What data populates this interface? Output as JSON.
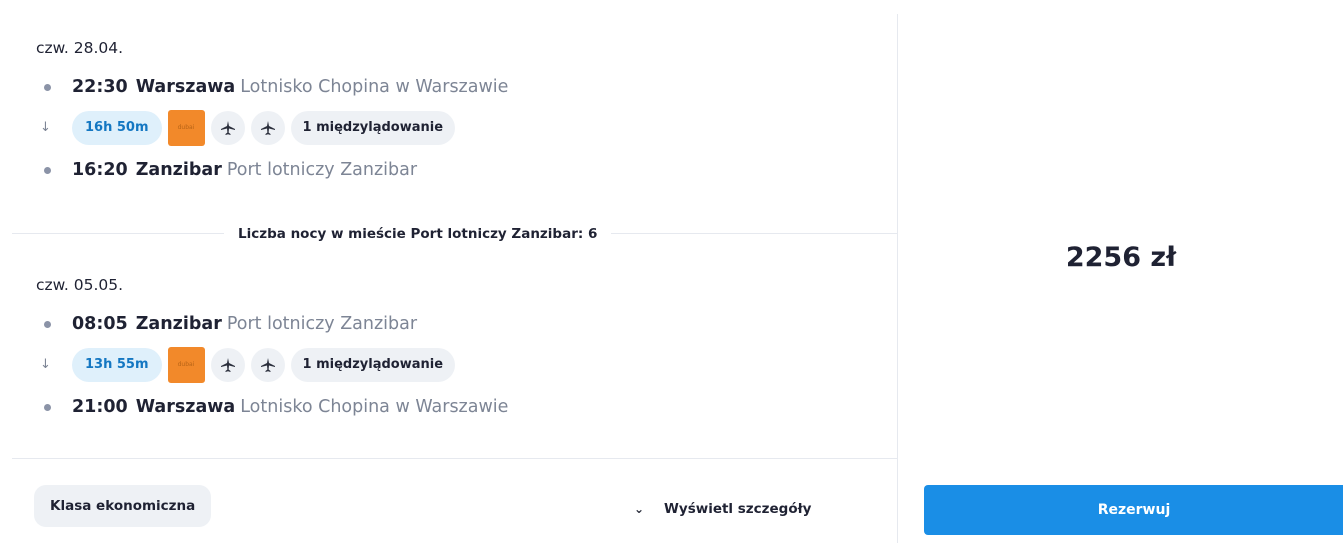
{
  "outbound": {
    "date": "czw. 28.04.",
    "departure": {
      "time": "22:30",
      "city": "Warszawa",
      "airport": "Lotnisko Chopina w Warszawie"
    },
    "duration": "16h 50m",
    "airline_logo_text": "dubai",
    "stops": "1 międzylądowanie",
    "arrival": {
      "time": "16:20",
      "city": "Zanzibar",
      "airport": "Port lotniczy Zanzibar"
    }
  },
  "nights_text": "Liczba nocy w mieście Port lotniczy Zanzibar: 6",
  "return": {
    "date": "czw. 05.05.",
    "departure": {
      "time": "08:05",
      "city": "Zanzibar",
      "airport": "Port lotniczy Zanzibar"
    },
    "duration": "13h 55m",
    "airline_logo_text": "dubai",
    "stops": "1 międzylądowanie",
    "arrival": {
      "time": "21:00",
      "city": "Warszawa",
      "airport": "Lotnisko Chopina w Warszawie"
    }
  },
  "footer": {
    "class_label": "Klasa ekonomiczna",
    "details_label": "Wyświetl szczegóły"
  },
  "price": "2256 zł",
  "book_label": "Rezerwuj",
  "icons": {
    "stop_dot": "dot-icon",
    "down_arrow": "arrow-down-icon",
    "plane": "airplane-icon",
    "chevron": "chevron-down-icon"
  },
  "colors": {
    "accent": "#1a8ee6",
    "duration_bg": "#dff0fb",
    "duration_text": "#1477c2",
    "airline_logo": "#f2892a",
    "muted_text": "#7d8595"
  }
}
